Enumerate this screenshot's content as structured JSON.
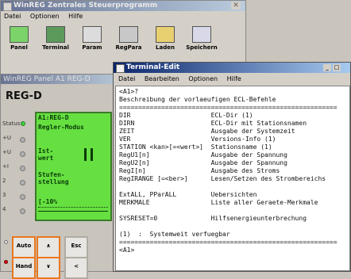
{
  "main_window": {
    "title": "WinREG Zentrales Steuerprogramm",
    "menu": [
      "Datei",
      "Optionen",
      "Hilfe"
    ],
    "toolbar": [
      "Panel",
      "Terminal",
      "Param",
      "RegPara",
      "Laden",
      "Speichern"
    ]
  },
  "panel": {
    "title": "WinREG Panel A1 REG-D",
    "device": "REG-D",
    "status_label": "Status",
    "rows": [
      "+U",
      "+U",
      "+I",
      "2",
      "3",
      "4"
    ],
    "lcd": [
      "A1:REG-D",
      "Regler-Modus",
      "Ist-",
      "wert",
      "Stufen-",
      "stellung",
      "[-10%"
    ],
    "buttons": {
      "auto": "Auto",
      "up": "∧",
      "esc": "Esc",
      "hand": "Hand",
      "down": "∨",
      "left": "<"
    }
  },
  "terminal": {
    "title": "Terminal-Edit",
    "menu": [
      "Datei",
      "Bearbeiten",
      "Optionen",
      "Hilfe"
    ],
    "lines": [
      "<A1>?",
      "Beschreibung der vorlaeufigen ECL-Befehle",
      "=========================================================",
      "DIR                     ECL-Dir (1)",
      "DIRN                    ECL-Dir mit Stationsnamen",
      "ZEIT                    Ausgabe der Systemzeit",
      "VER                     Versions-Info (1)",
      "STATION <kan>[=<wert>]  Stationsname (1)",
      "RegU1[n]                Ausgabe der Spannung",
      "RegU2[n]                Ausgabe der Spannung",
      "RegI[n]                 Ausgabe des Stroms",
      "RegIRANGE [=<ber>]      Lesen/Setzen des Strombereichs",
      "",
      "ExtALL, PParALL         Uebersichten",
      "MERKMALE                Liste aller Geraete-Merkmale",
      "",
      "SYSRESET=0              Hilfsenergieunterbrechung",
      "",
      "(1)  :  Systemweit verfuegbar",
      "=========================================================",
      "<A1>"
    ]
  },
  "colors": {
    "accent": "#0a246a",
    "lcd_green": "#66e040",
    "button_border": "#e87820"
  }
}
